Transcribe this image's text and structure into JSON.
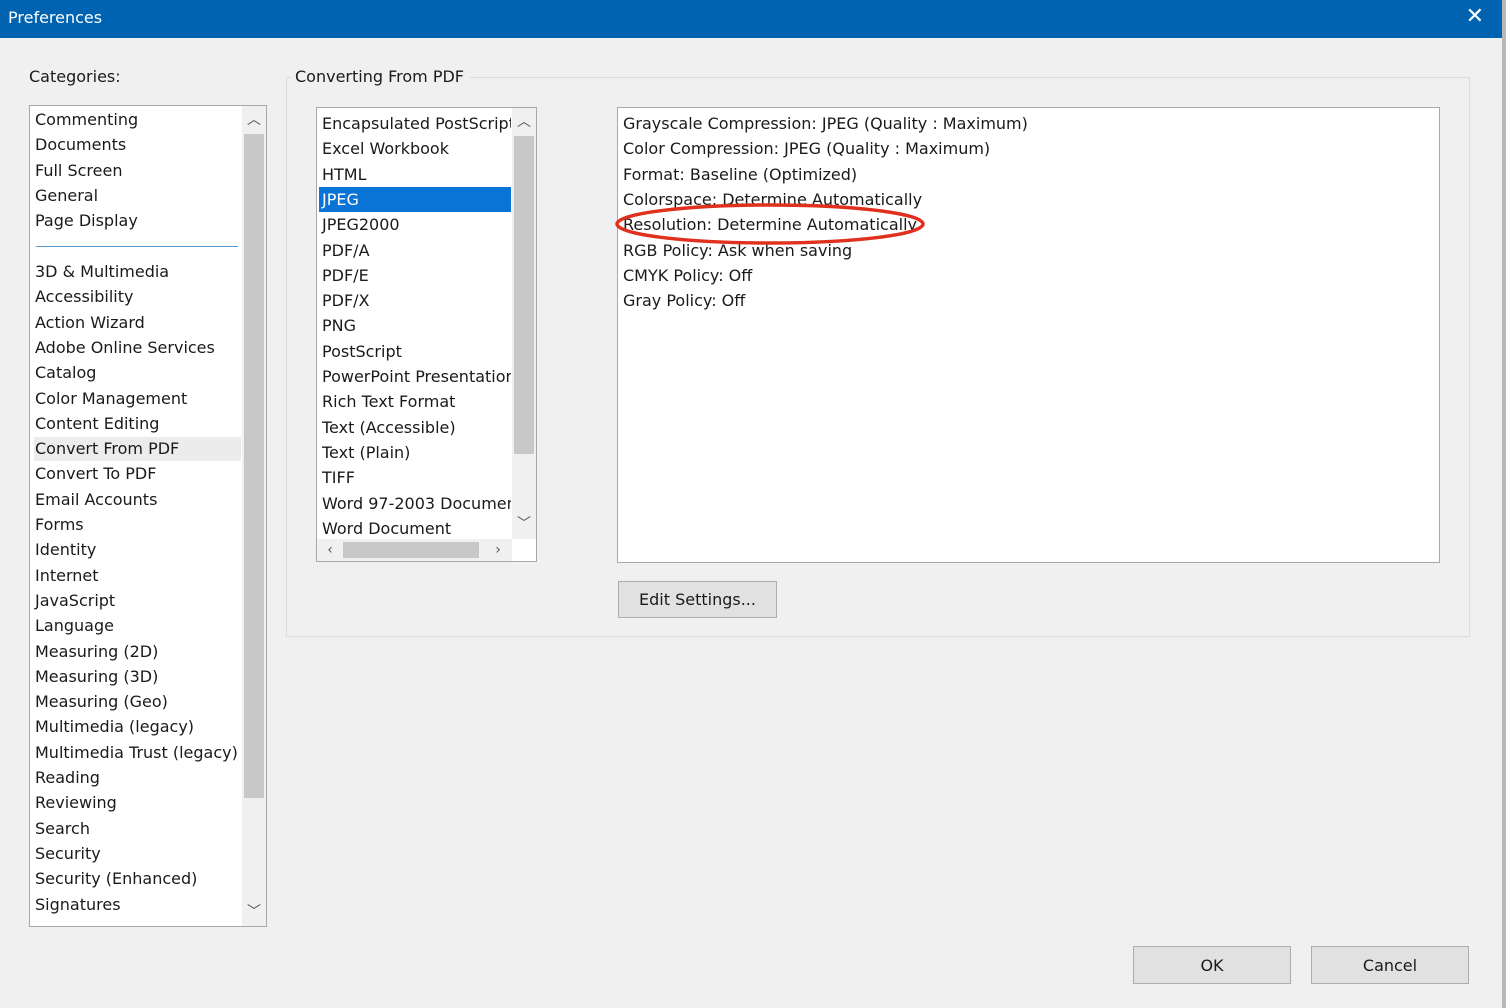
{
  "window": {
    "title": "Preferences",
    "close_glyph": "✕"
  },
  "categories": {
    "label": "Categories:",
    "top_items": [
      "Commenting",
      "Documents",
      "Full Screen",
      "General",
      "Page Display"
    ],
    "items": [
      "3D & Multimedia",
      "Accessibility",
      "Action Wizard",
      "Adobe Online Services",
      "Catalog",
      "Color Management",
      "Content Editing",
      "Convert From PDF",
      "Convert To PDF",
      "Email Accounts",
      "Forms",
      "Identity",
      "Internet",
      "JavaScript",
      "Language",
      "Measuring (2D)",
      "Measuring (3D)",
      "Measuring (Geo)",
      "Multimedia (legacy)",
      "Multimedia Trust (legacy)",
      "Reading",
      "Reviewing",
      "Search",
      "Security",
      "Security (Enhanced)",
      "Signatures"
    ],
    "selected": "Convert From PDF"
  },
  "group": {
    "label": "Converting From PDF"
  },
  "formats": {
    "items": [
      "Encapsulated PostScript",
      "Excel Workbook",
      "HTML",
      "JPEG",
      "JPEG2000",
      "PDF/A",
      "PDF/E",
      "PDF/X",
      "PNG",
      "PostScript",
      "PowerPoint Presentation",
      "Rich Text Format",
      "Text (Accessible)",
      "Text (Plain)",
      "TIFF",
      "Word 97-2003 Documen",
      "Word Document"
    ],
    "selected": "JPEG"
  },
  "settings": {
    "lines": [
      "Grayscale Compression: JPEG (Quality : Maximum)",
      "Color Compression: JPEG (Quality : Maximum)",
      "Format: Baseline (Optimized)",
      "Colorspace: Determine Automatically",
      "Resolution: Determine Automatically",
      "RGB Policy: Ask when saving",
      "CMYK Policy: Off",
      "Gray Policy: Off"
    ],
    "highlighted": "Resolution: Determine Automatically",
    "annotation_color": "#e0301e"
  },
  "buttons": {
    "edit_settings": "Edit Settings...",
    "ok": "OK",
    "cancel": "Cancel"
  },
  "icons": {
    "up": "chevron-up-icon",
    "down": "chevron-down-icon",
    "left": "chevron-left-icon",
    "right": "chevron-right-icon",
    "close": "close-icon"
  },
  "colors": {
    "titlebar": "#0063b1",
    "selection": "#0a74d6"
  }
}
